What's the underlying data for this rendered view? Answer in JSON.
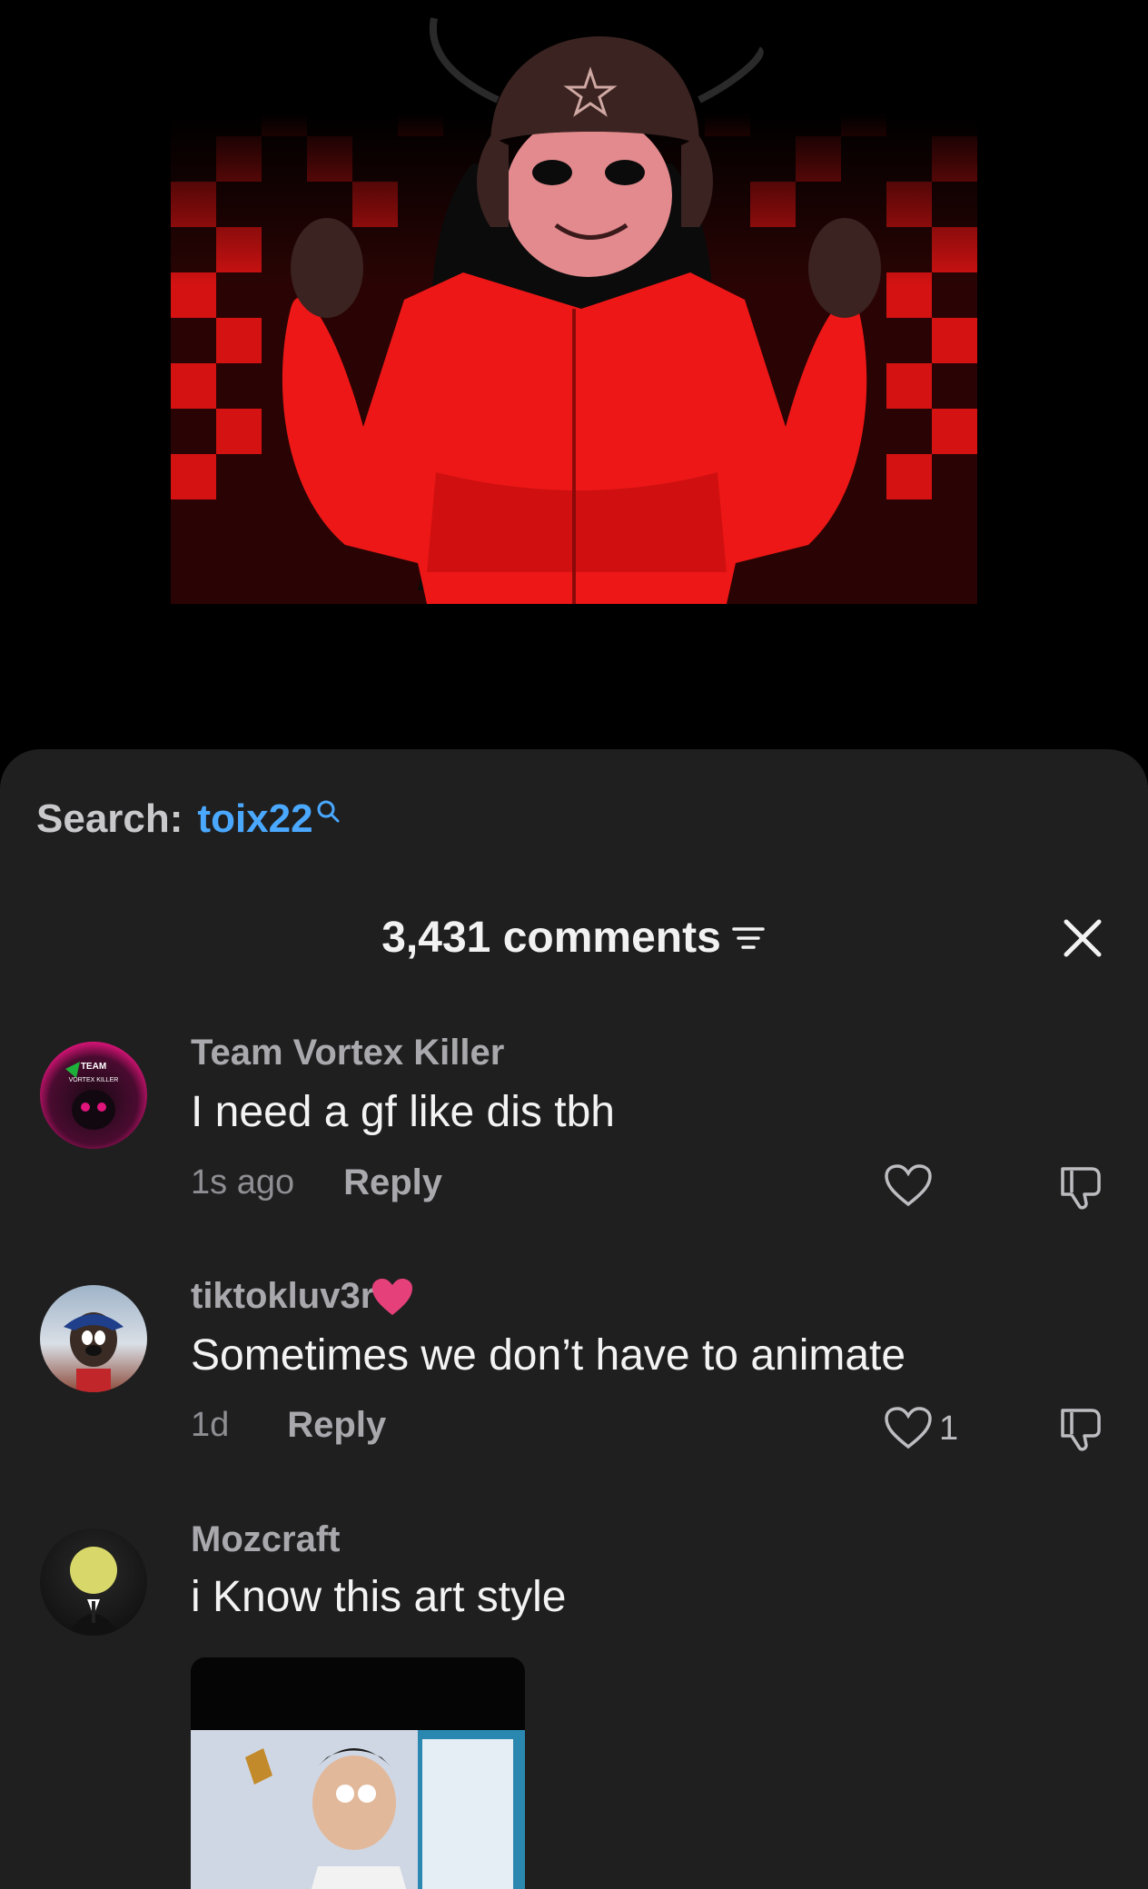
{
  "search": {
    "label": "Search:",
    "term": "toix22"
  },
  "header": {
    "comment_count": "3,431 comments"
  },
  "comments": [
    {
      "username": "Team Vortex Killer",
      "text": "I need a gf like dis tbh",
      "time": "1s ago",
      "reply_label": "Reply",
      "likes": "",
      "avatar_text": "TEAM VORTEX KILLER"
    },
    {
      "username": "tiktokluv3r",
      "text": "Sometimes we don’t have to animate",
      "time": "1d",
      "reply_label": "Reply",
      "likes": "1"
    },
    {
      "username": "Mozcraft",
      "text": "i Know this art style",
      "time": "",
      "reply_label": "",
      "likes": ""
    }
  ],
  "colors": {
    "sheet_bg": "#1f1f20",
    "link_blue": "#4aa8ff",
    "heart_pink": "#e5407a",
    "accent_red": "#e0191a"
  },
  "icons": [
    "search-icon",
    "filter-icon",
    "close-icon",
    "heart-icon",
    "dislike-icon"
  ]
}
